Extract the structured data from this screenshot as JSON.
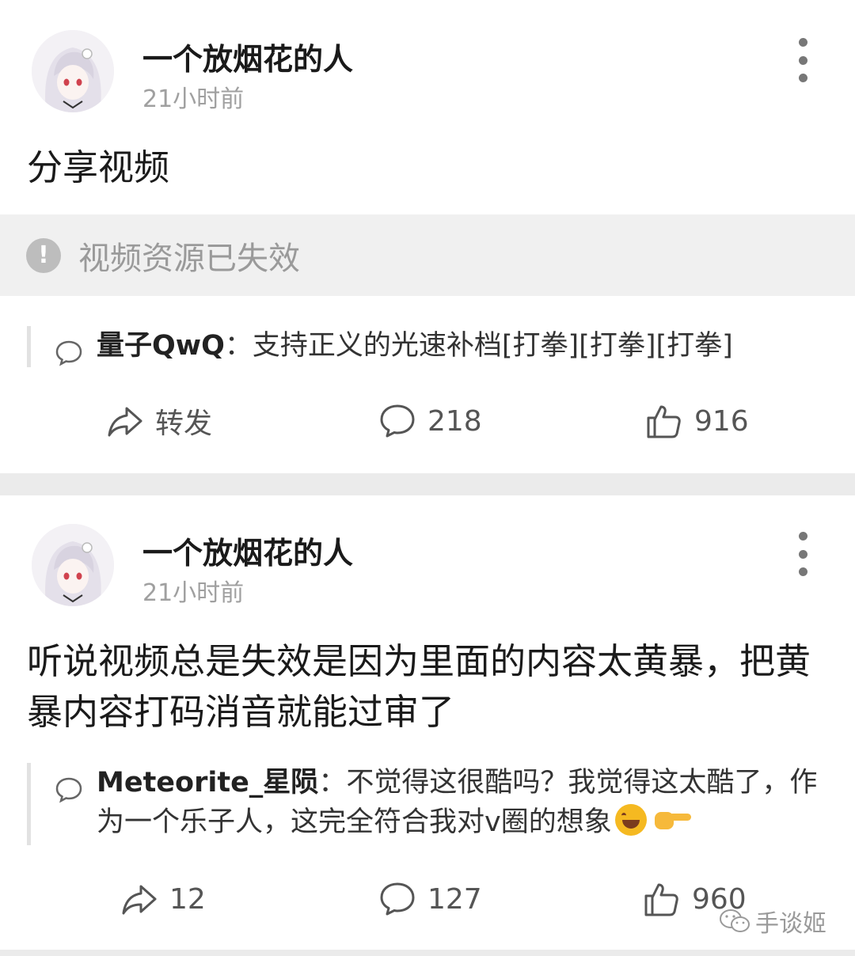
{
  "posts": [
    {
      "username": "一个放烟花的人",
      "time": "21小时前",
      "text": "分享视频",
      "invalid_notice": "视频资源已失效",
      "comment": {
        "user": "量子QwQ",
        "separator": "：",
        "text": "支持正义的光速补档[打拳][打拳][打拳]"
      },
      "actions": {
        "repost": "转发",
        "comments": "218",
        "likes": "916"
      }
    },
    {
      "username": "一个放烟花的人",
      "time": "21小时前",
      "text": "听说视频总是失效是因为里面的内容太黄暴，把黄暴内容打码消音就能过审了",
      "comment": {
        "user": "Meteorite_星陨",
        "separator": "：",
        "text": "不觉得这很酷吗？我觉得这太酷了，作为一个乐子人，这完全符合我对v圈的想象"
      },
      "actions": {
        "repost": "12",
        "comments": "127",
        "likes": "960"
      }
    }
  ],
  "watermark": "手谈姬",
  "icons": {
    "more": "more-vertical-icon",
    "warning": "warning-icon",
    "comment_bubble": "comment-bubble-icon",
    "repost": "share-arrow-icon",
    "comment": "comment-icon",
    "like": "thumbs-up-icon",
    "watermark": "wechat-icon"
  },
  "colors": {
    "page_bg": "#ebebeb",
    "card_bg": "#ffffff",
    "muted": "#a0a0a0",
    "notice_bg": "#f0f0f0"
  }
}
